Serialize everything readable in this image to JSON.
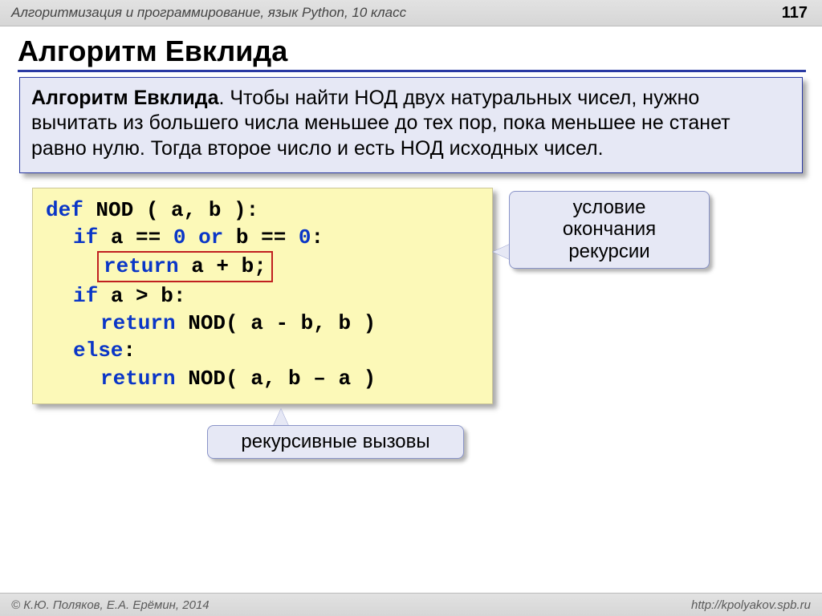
{
  "header": {
    "course": "Алгоритмизация и программирование, язык Python, 10 класс",
    "page": "117"
  },
  "title": "Алгоритм Евклида",
  "definition": {
    "term": "Алгоритм Евклида",
    "text": ". Чтобы найти НОД двух натуральных чисел, нужно вычитать из большего числа меньшее до тех пор, пока меньшее не станет равно нулю. Тогда второе число и есть НОД исходных чисел."
  },
  "code": {
    "kw_def": "def",
    "fn": "NOD ( a, b ):",
    "kw_if": "if",
    "cond1_a": "a == ",
    "zero1": "0",
    "kw_or": "or",
    "cond1_b": " b == ",
    "zero2": "0",
    "colon": ":",
    "kw_return": "return",
    "ret1": " a + b;",
    "cond2": " a > b:",
    "call1_pre": " NOD",
    "call1_args": "( a - b, b )",
    "kw_else": "else",
    "else_colon": ":",
    "call2_pre": " NOD",
    "call2_args": "( a, b – a )"
  },
  "callouts": {
    "c1_line1": "условие",
    "c1_line2": "окончания",
    "c1_line3": "рекурсии",
    "c2": "рекурсивные вызовы"
  },
  "footer": {
    "left": "© К.Ю. Поляков, Е.А. Ерёмин, 2014",
    "right": "http://kpolyakov.spb.ru"
  }
}
